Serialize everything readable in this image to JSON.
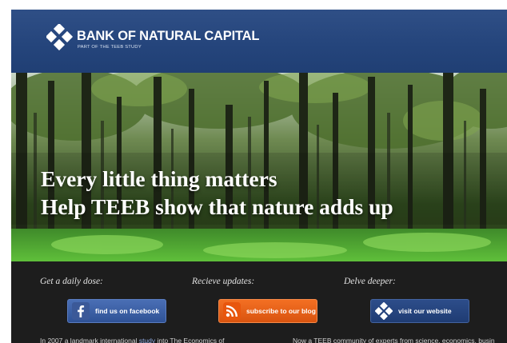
{
  "header": {
    "brand": "BANK OF NATURAL CAPITAL",
    "tagline": "PART OF THE TEEB STUDY"
  },
  "hero": {
    "line1": "Every little thing matters",
    "line2": "Help TEEB show that nature adds up"
  },
  "cta": [
    {
      "label": "Get a daily dose:",
      "button": "find us on facebook",
      "icon": "facebook-icon",
      "color": "#3b5998"
    },
    {
      "label": "Recieve updates:",
      "button": "subscribe to our blog",
      "icon": "rss-icon",
      "color": "#f26522"
    },
    {
      "label": "Delve deeper:",
      "button": "visit our website",
      "icon": "diamond-logo-icon",
      "color": "#22427a"
    }
  ],
  "body": {
    "left_a": "In 2007 a landmark international ",
    "left_link": "study",
    "left_b": " into The Economics of",
    "right": "Now a TEEB community of experts from science, economics, busin"
  },
  "colors": {
    "header_blue": "#2a4a80",
    "band_dark": "#1d1d1d"
  }
}
